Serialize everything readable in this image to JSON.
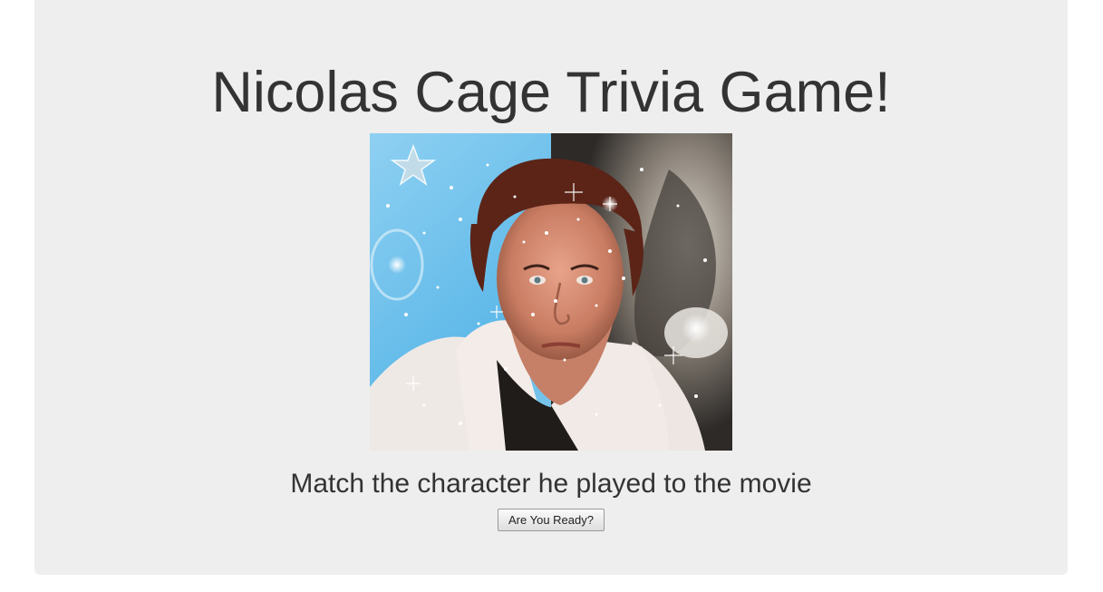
{
  "page": {
    "title": "Nicolas Cage Trivia Game!",
    "subtitle": "Match the character he played to the movie",
    "start_button_label": "Are You Ready?"
  },
  "image": {
    "subject": "glittery portrait of Nicolas Cage with star and cat background"
  },
  "colors": {
    "panel_background": "#eeeeee",
    "text": "#333333"
  }
}
